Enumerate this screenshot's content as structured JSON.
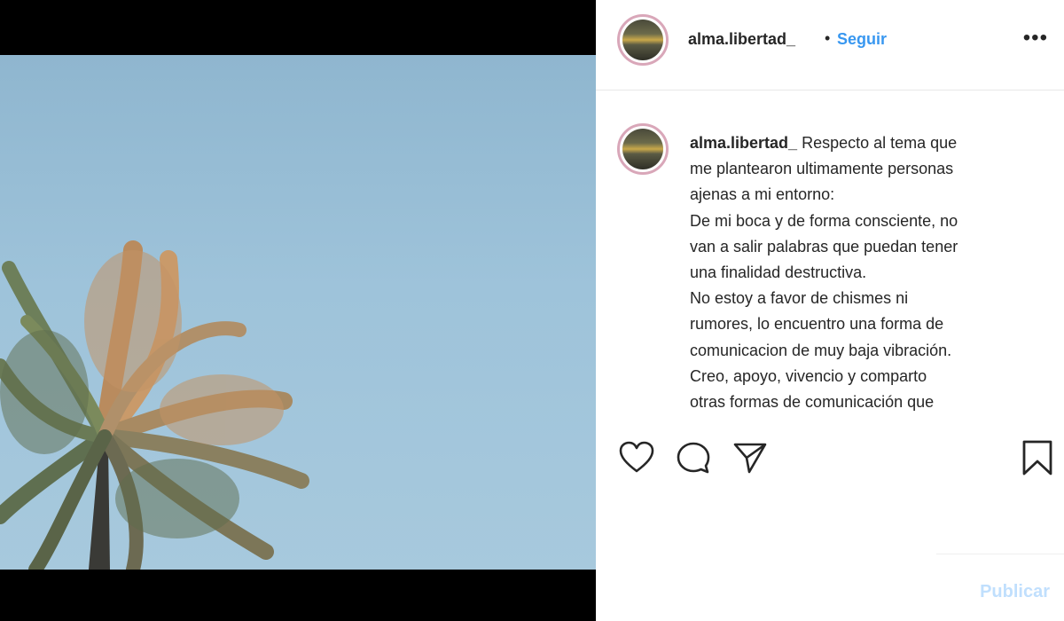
{
  "post": {
    "username": "alma.libertad_",
    "separator": "•",
    "follow_label": "Seguir",
    "more_label": "•••",
    "caption_lines": [
      "Respecto al tema que",
      "me plantearon ultimamente personas",
      "ajenas a mi entorno:",
      "De mi boca y de forma consciente, no",
      "van a salir palabras que puedan tener",
      "una finalidad destructiva.",
      "No estoy a favor de chismes ni",
      "rumores, lo encuentro una forma de",
      "comunicacion de muy baja vibración.",
      "Creo, apoyo, vivencio y comparto",
      "otras formas de comunicación que"
    ],
    "publish_label": "Publicar"
  },
  "icons": [
    "heart-icon",
    "comment-icon",
    "share-icon",
    "bookmark-icon",
    "more-options-icon"
  ],
  "colors": {
    "link_blue": "#3897f0",
    "publish_disabled": "#c0dffd",
    "text": "#262626",
    "sky": "#9ec3da",
    "avatar_ring": "#d9a7b9"
  }
}
